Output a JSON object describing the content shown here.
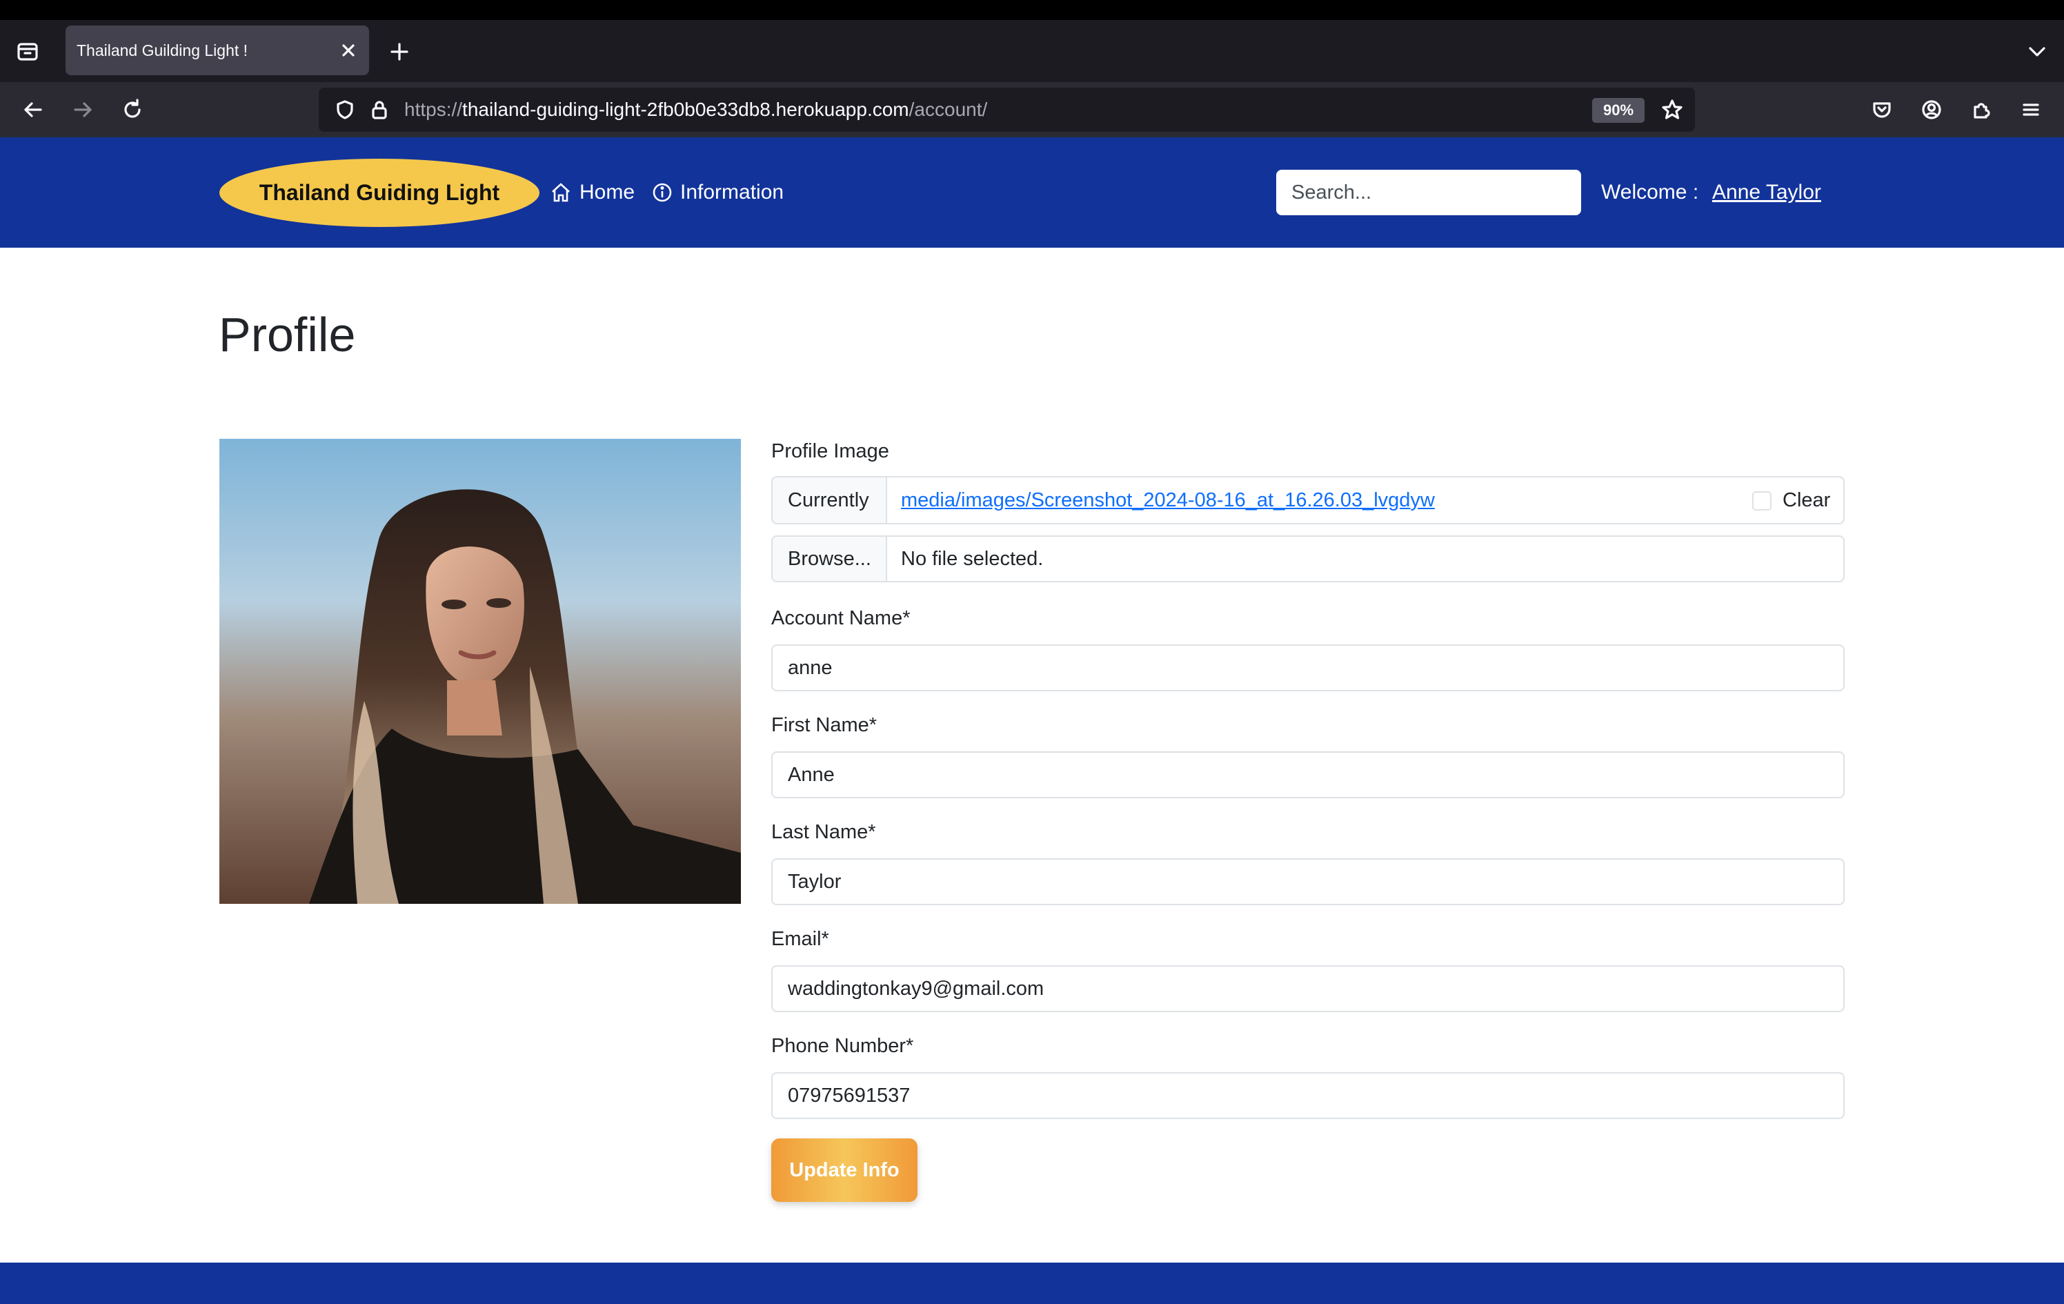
{
  "browser": {
    "tab_title": "Thailand Guilding Light !",
    "url_prefix": "https://",
    "url_host": "thailand-guiding-light-2fb0b0e33db8.herokuapp.com",
    "url_path": "/account/",
    "zoom": "90%",
    "icons": [
      "tab-overview-icon",
      "close-icon",
      "new-tab-icon",
      "tab-list-chevron-icon",
      "back-icon",
      "forward-icon",
      "reload-icon",
      "shield-icon",
      "lock-icon",
      "bookmark-star-icon",
      "pocket-icon",
      "account-icon",
      "extensions-icon",
      "menu-icon"
    ]
  },
  "header": {
    "brand": "Thailand Guiding Light",
    "nav": [
      {
        "label": "Home",
        "icon": "home-icon"
      },
      {
        "label": "Information",
        "icon": "info-icon"
      }
    ],
    "search_placeholder": "Search...",
    "welcome_label": "Welcome :",
    "user_name": "Anne Taylor",
    "colors": {
      "header_bg": "#12339a",
      "brand_bg": "#f5c84b"
    }
  },
  "main": {
    "title": "Profile",
    "photo_alt": "Profile photo",
    "form": {
      "profile_image_label": "Profile Image",
      "currently_label": "Currently",
      "current_file": "media/images/Screenshot_2024-08-16_at_16.26.03_lvgdyw",
      "clear_label": "Clear",
      "browse_label": "Browse...",
      "no_file_text": "No file selected.",
      "account_name_label": "Account Name*",
      "account_name": "anne",
      "first_name_label": "First Name*",
      "first_name": "Anne",
      "last_name_label": "Last Name*",
      "last_name": "Taylor",
      "email_label": "Email*",
      "email": "waddingtonkay9@gmail.com",
      "phone_label": "Phone Number*",
      "phone": "07975691537",
      "submit_label": "Update Info",
      "submit_color": "#f09a38"
    }
  }
}
